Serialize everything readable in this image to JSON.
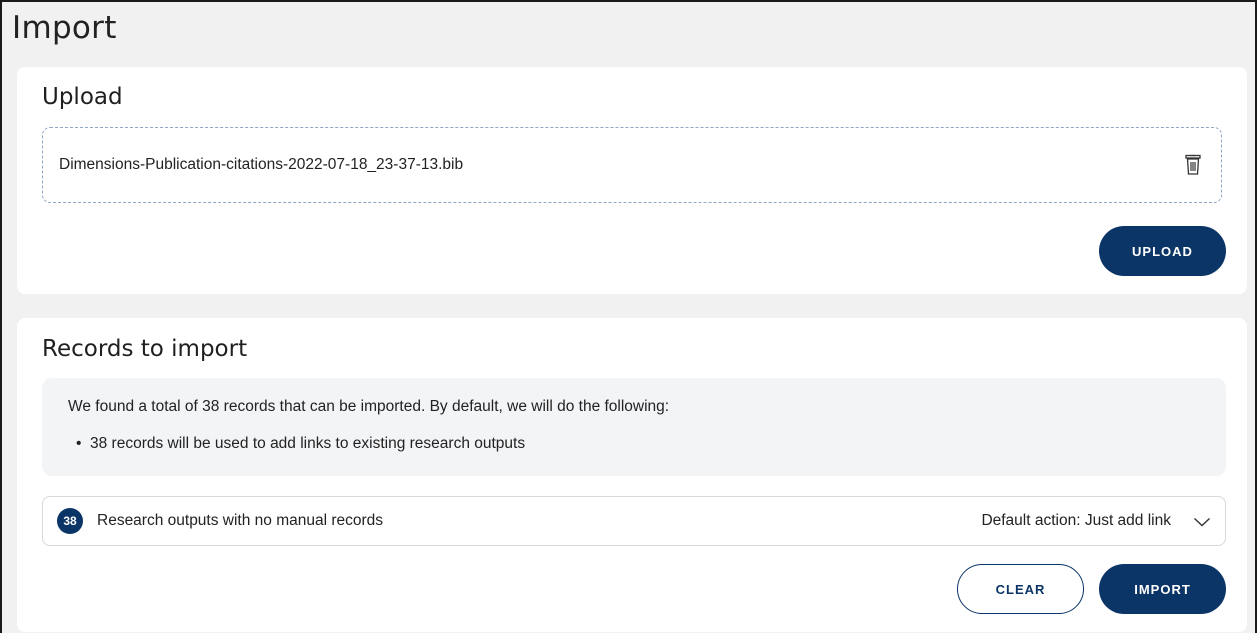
{
  "page": {
    "title": "Import"
  },
  "upload": {
    "title": "Upload",
    "file_name": "Dimensions-Publication-citations-2022-07-18_23-37-13.bib",
    "delete_icon": "trash-icon",
    "upload_label": "UPLOAD"
  },
  "records": {
    "title": "Records to import",
    "summary": "We found a total of 38 records that can be imported. By default, we will do the following:",
    "bullet_symbol": "•",
    "bullets": [
      "38 records will be used to add links to existing research outputs"
    ],
    "group": {
      "count": "38",
      "label": "Research outputs with no manual records",
      "action": "Default action: Just add link",
      "expand_icon": "chevron-down-icon"
    },
    "clear_label": "CLEAR",
    "import_label": "IMPORT"
  },
  "colors": {
    "accent": "#0b3566",
    "background": "#f1f1f1",
    "card": "#ffffff",
    "dashed_border": "#8ea6c4"
  }
}
